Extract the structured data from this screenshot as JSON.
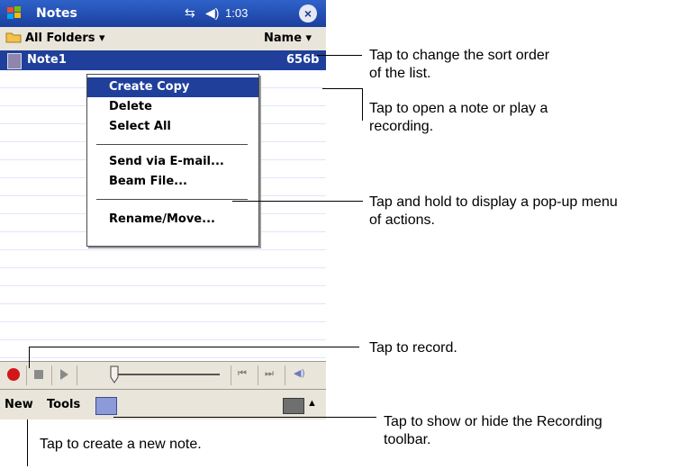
{
  "titlebar": {
    "app_title": "Notes",
    "time": "1:03"
  },
  "folder_bar": {
    "folder_label": "All Folders ▾",
    "sort_label": "Name ▾"
  },
  "note_row": {
    "name": "Note1",
    "size": "656b"
  },
  "popup_menu": {
    "items": [
      "Create Copy",
      "Delete",
      "Select All",
      "Send via E-mail...",
      "Beam File...",
      "Rename/Move..."
    ],
    "selected": "Create Copy"
  },
  "command_bar": {
    "new_label": "New",
    "tools_label": "Tools"
  },
  "callouts": {
    "sort": "Tap to change the sort order\nof the list.",
    "open": "Tap to open a note or play a\nrecording.",
    "hold": "Tap and hold to display a pop-up menu\nof actions.",
    "record": "Tap to record.",
    "toggle": "Tap to show or hide the Recording\ntoolbar.",
    "new": "Tap to create a new note."
  },
  "colors": {
    "title_blue": "#1f3f9a",
    "record_red": "#d01818",
    "bar_beige": "#e9e5da"
  }
}
